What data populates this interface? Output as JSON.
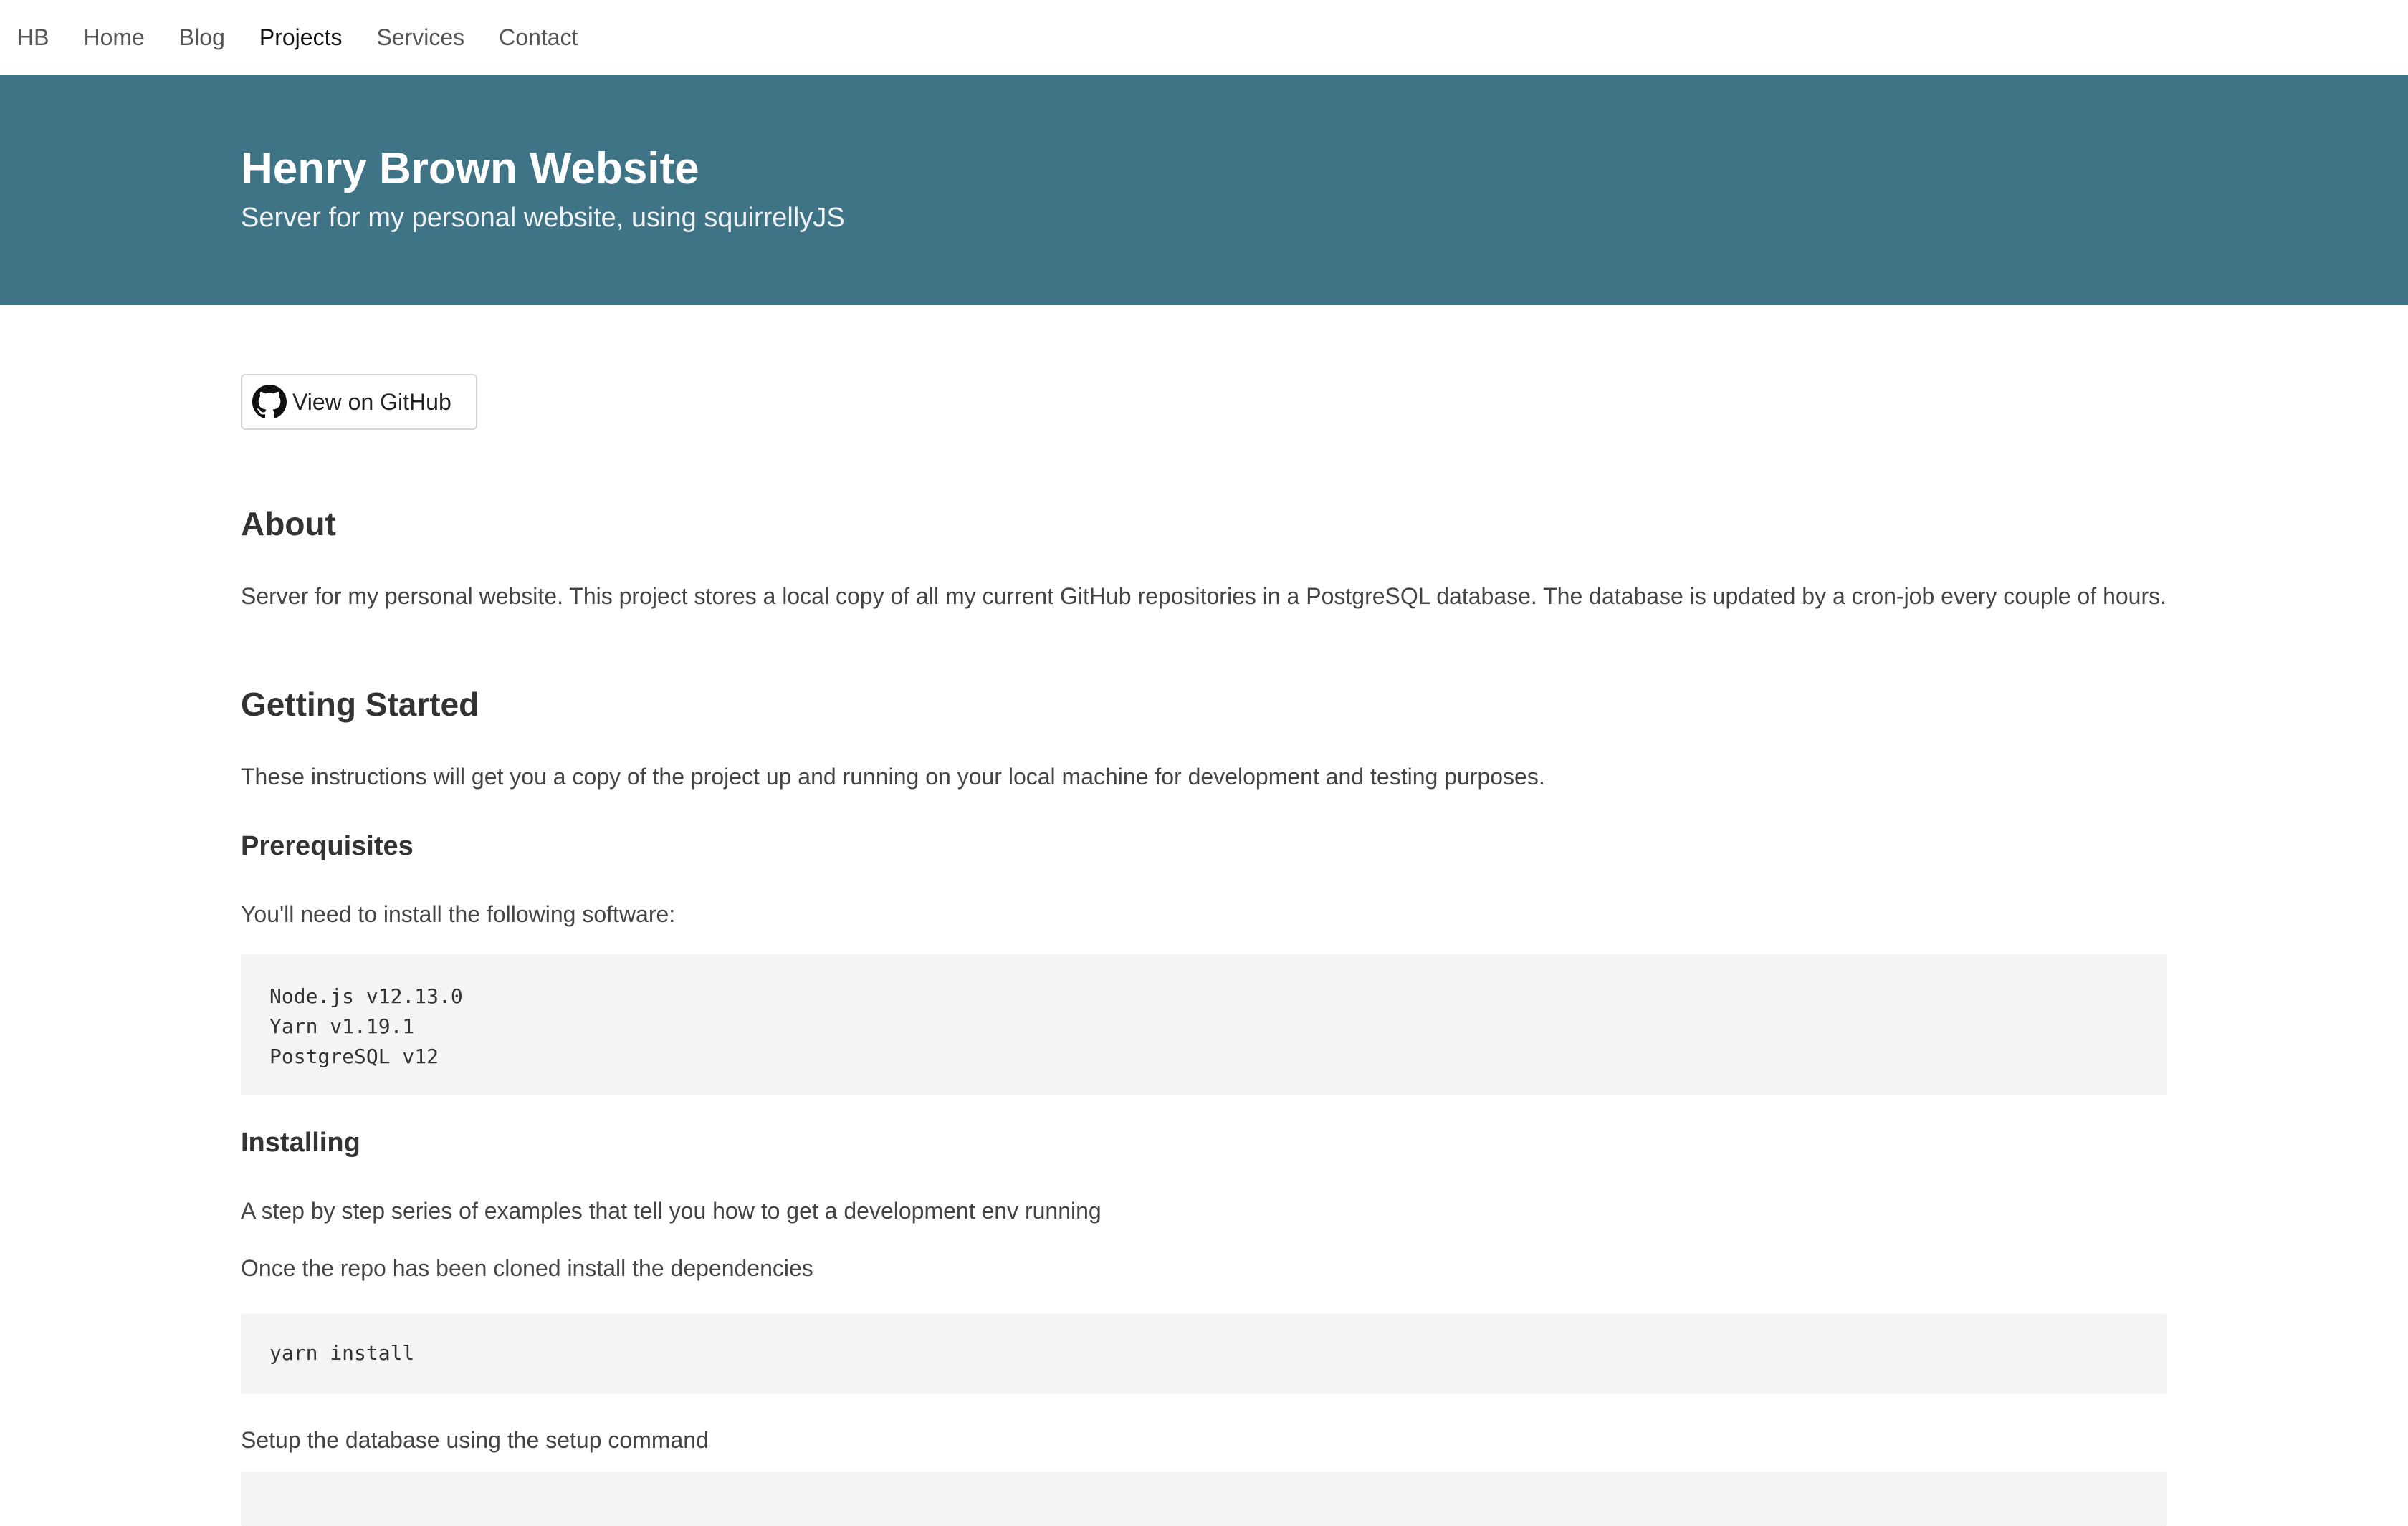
{
  "nav": {
    "brand": "HB",
    "items": [
      {
        "label": "Home",
        "active": false
      },
      {
        "label": "Blog",
        "active": false
      },
      {
        "label": "Projects",
        "active": true
      },
      {
        "label": "Services",
        "active": false
      },
      {
        "label": "Contact",
        "active": false
      }
    ]
  },
  "hero": {
    "title": "Henry Brown Website",
    "subtitle": "Server for my personal website, using squirrellyJS",
    "background_color": "#3f7386"
  },
  "github_button": {
    "label": "View on GitHub",
    "icon": "github-icon"
  },
  "about": {
    "heading": "About",
    "text": "Server for my personal website. This project stores a local copy of all my current GitHub repositories in a PostgreSQL database. The database is updated by a cron-job every couple of hours."
  },
  "getting_started": {
    "heading": "Getting Started",
    "text": "These instructions will get you a copy of the project up and running on your local machine for development and testing purposes."
  },
  "prerequisites": {
    "heading": "Prerequisites",
    "text": "You'll need to install the following software:",
    "code_lines": [
      "Node.js v12.13.0",
      "Yarn v1.19.1",
      "PostgreSQL v12"
    ]
  },
  "installing": {
    "heading": "Installing",
    "text1": "A step by step series of examples that tell you how to get a development env running",
    "text2": "Once the repo has been cloned install the dependencies",
    "code1": "yarn install",
    "text3": "Setup the database using the setup command"
  }
}
